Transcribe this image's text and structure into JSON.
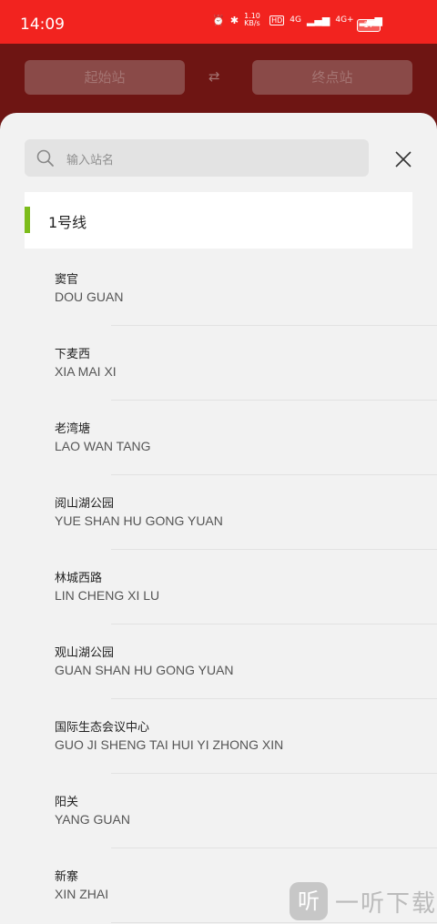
{
  "status_bar": {
    "time": "14:09",
    "speed": "1.10 KB/s",
    "net1": "4G",
    "net2": "4G+",
    "battery": "17"
  },
  "header": {
    "start_label": "起始站",
    "end_label": "终点站",
    "swap_symbol": "⇄"
  },
  "sheet": {
    "search_placeholder": "输入站名",
    "line_name": "1号线",
    "line_color": "#7cbc1b",
    "stations": [
      {
        "cn": "窦官",
        "py": "DOU GUAN"
      },
      {
        "cn": "下麦西",
        "py": "XIA MAI XI"
      },
      {
        "cn": "老湾塘",
        "py": "LAO WAN TANG"
      },
      {
        "cn": "阅山湖公园",
        "py": "YUE SHAN HU GONG YUAN"
      },
      {
        "cn": "林城西路",
        "py": "LIN CHENG XI LU"
      },
      {
        "cn": "观山湖公园",
        "py": "GUAN SHAN HU GONG YUAN"
      },
      {
        "cn": "国际生态会议中心",
        "py": "GUO JI SHENG TAI HUI YI ZHONG XIN"
      },
      {
        "cn": "阳关",
        "py": "YANG GUAN"
      },
      {
        "cn": "新寨",
        "py": "XIN ZHAI"
      }
    ]
  },
  "watermark": {
    "logo_char": "听",
    "text": "一听下载"
  }
}
